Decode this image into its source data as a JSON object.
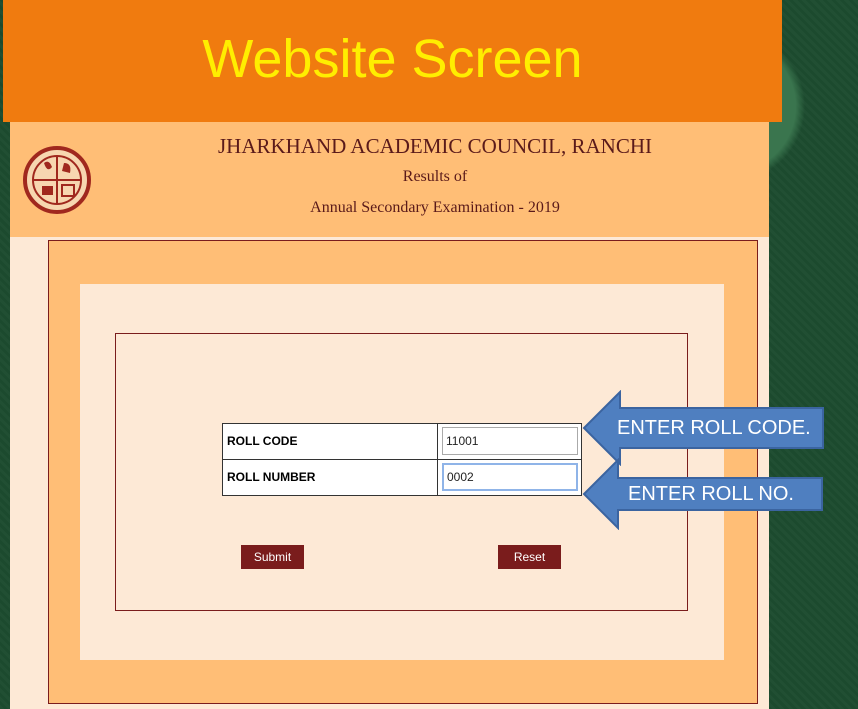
{
  "banner": {
    "title": "Website Screen"
  },
  "header": {
    "council": "JHARKHAND ACADEMIC COUNCIL, RANCHI",
    "results_of": "Results of",
    "exam": "Annual Secondary Examination - 2019"
  },
  "form": {
    "roll_code_label": "ROLL CODE",
    "roll_code_value": "11001",
    "roll_number_label": "ROLL NUMBER",
    "roll_number_value": "0002",
    "submit_label": "Submit",
    "reset_label": "Reset"
  },
  "callouts": {
    "roll_code": "ENTER ROLL CODE.",
    "roll_no": "ENTER ROLL NO."
  },
  "colors": {
    "banner": "#f07b0f",
    "banner_text": "#ffee00",
    "header": "#ffbe76",
    "panel": "#fde9d6",
    "maroon": "#7a1c1c",
    "callout_blue": "#4f7fc0"
  }
}
